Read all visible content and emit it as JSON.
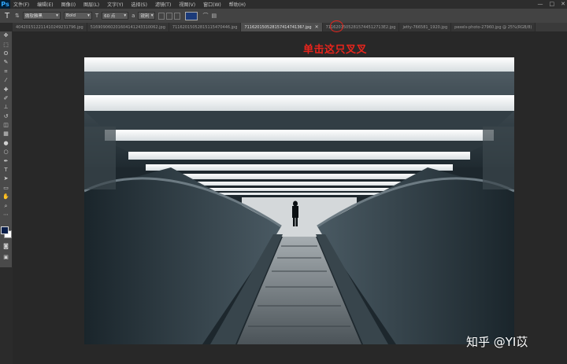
{
  "menubar": {
    "logo": "Ps",
    "items": [
      "文件(F)",
      "编辑(E)",
      "图像(I)",
      "图层(L)",
      "文字(Y)",
      "选择(S)",
      "滤镜(T)",
      "视图(V)",
      "窗口(W)",
      "帮助(H)"
    ],
    "window_controls": [
      "—",
      "□",
      "✕"
    ]
  },
  "options": {
    "font_family": "微软雅黑",
    "font_style": "Bold",
    "font_size": "60 点",
    "anti_alias": "锐利",
    "text_color": "#1c3b7a"
  },
  "tabs": [
    {
      "label": "404201512211410249231796.jpg",
      "active": false
    },
    {
      "label": "516909060201604141243310062.jpg",
      "active": false
    },
    {
      "label": "71162015052815115470446.jpg",
      "active": false
    },
    {
      "label": "71162015052815741474136?.jpg",
      "active": true,
      "close": "✕"
    },
    {
      "label": "71162015052815744512713E2.jpg",
      "active": false
    },
    {
      "label": "jetty-766581_1920.jpg",
      "active": false
    },
    {
      "label": "pexels-photo-27960.jpg @ 25%(RGB/8)",
      "active": false
    }
  ],
  "annotation": {
    "text": "单击这只叉叉",
    "color": "#e8241c"
  },
  "watermark": {
    "text": "知乎 @YI苡"
  },
  "colors": {
    "foreground": "#0b1f4a",
    "background": "#ffffff"
  },
  "tools": [
    "move-icon",
    "marquee-icon",
    "lasso-icon",
    "quick-select-icon",
    "crop-icon",
    "eyedropper-icon",
    "healing-icon",
    "brush-icon",
    "clone-stamp-icon",
    "history-brush-icon",
    "eraser-icon",
    "gradient-icon",
    "blur-icon",
    "dodge-icon",
    "pen-icon",
    "type-icon",
    "path-select-icon",
    "shape-icon",
    "hand-icon",
    "zoom-icon"
  ]
}
